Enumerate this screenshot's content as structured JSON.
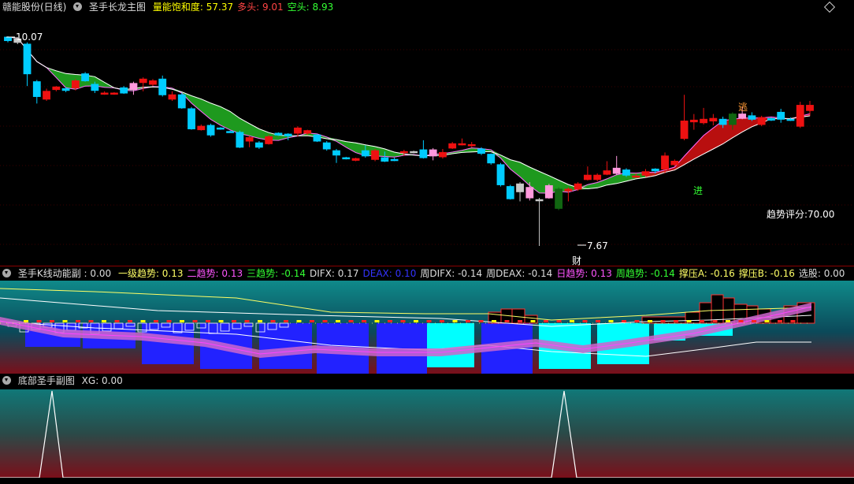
{
  "main": {
    "stock_name": "赣能股份(日线)",
    "indicator_name": "圣手长龙主图",
    "fields": [
      {
        "label": "量能饱和度:",
        "value": "57.37",
        "color": "#ffff00"
      },
      {
        "label": "多头:",
        "value": "9.01",
        "color": "#ff4444"
      },
      {
        "label": "空头:",
        "value": "8.93",
        "color": "#33ff33"
      }
    ],
    "high_label": "10.07",
    "low_label": "7.67",
    "escape_label": "逃",
    "enter_label": "进",
    "wealth_label": "财",
    "score_label": "趋势评分:70.00"
  },
  "sub1": {
    "indicator_name": "圣手K线动能副",
    "indicator_value": ": 0.00",
    "fields": [
      {
        "label": "一级趋势:",
        "value": "0.13",
        "color": "#ffff66"
      },
      {
        "label": "二趋势:",
        "value": "0.13",
        "color": "#ff55ff"
      },
      {
        "label": "三趋势:",
        "value": "-0.14",
        "color": "#33ff33"
      },
      {
        "label": "DIFX:",
        "value": "0.17",
        "color": "#dddddd"
      },
      {
        "label": "DEAX:",
        "value": "0.10",
        "color": "#3333ff"
      },
      {
        "label": "周DIFX:",
        "value": "-0.14",
        "color": "#dddddd"
      },
      {
        "label": "周DEAX:",
        "value": "-0.14",
        "color": "#dddddd"
      },
      {
        "label": "日趋势:",
        "value": "0.13",
        "color": "#ff55ff"
      },
      {
        "label": "周趋势:",
        "value": "-0.14",
        "color": "#33ff33"
      },
      {
        "label": "撑压A:",
        "value": "-0.16",
        "color": "#ffff66"
      },
      {
        "label": "撑压B:",
        "value": "-0.16",
        "color": "#ffff66"
      },
      {
        "label": "选股:",
        "value": "0.00",
        "color": "#dddddd"
      }
    ]
  },
  "sub2": {
    "indicator_name": "底部圣手副图",
    "fields": [
      {
        "label": "XG:",
        "value": "0.00",
        "color": "#dddddd"
      }
    ]
  },
  "chart_data": {
    "type": "candlestick",
    "candles": [
      {
        "o": 10.02,
        "c": 10.06,
        "h": 10.07,
        "l": 10.0,
        "color": "cyan"
      },
      {
        "o": 10.0,
        "c": 10.04,
        "h": 10.06,
        "l": 9.98,
        "color": "gray"
      },
      {
        "o": 9.98,
        "c": 9.64,
        "h": 10.0,
        "l": 9.5,
        "color": "cyan"
      },
      {
        "o": 9.55,
        "c": 9.38,
        "h": 9.57,
        "l": 9.3,
        "color": "cyan"
      },
      {
        "o": 9.35,
        "c": 9.44,
        "h": 9.47,
        "l": 9.33,
        "color": "red"
      },
      {
        "o": 9.46,
        "c": 9.49,
        "h": 9.5,
        "l": 9.44,
        "color": "red"
      },
      {
        "o": 9.47,
        "c": 9.45,
        "h": 9.49,
        "l": 9.43,
        "color": "cyan"
      },
      {
        "o": 9.48,
        "c": 9.56,
        "h": 9.58,
        "l": 9.45,
        "color": "red"
      },
      {
        "o": 9.64,
        "c": 9.56,
        "h": 9.66,
        "l": 9.55,
        "color": "cyan"
      },
      {
        "o": 9.52,
        "c": 9.45,
        "h": 9.55,
        "l": 9.42,
        "color": "cyan"
      },
      {
        "o": 9.42,
        "c": 9.41,
        "h": 9.44,
        "l": 9.4,
        "color": "red"
      },
      {
        "o": 9.42,
        "c": 9.42,
        "h": 9.43,
        "l": 9.4,
        "color": "red"
      },
      {
        "o": 9.48,
        "c": 9.42,
        "h": 9.5,
        "l": 9.41,
        "color": "cyan"
      },
      {
        "o": 9.46,
        "c": 9.53,
        "h": 9.55,
        "l": 9.4,
        "color": "pink"
      },
      {
        "o": 9.54,
        "c": 9.58,
        "h": 9.6,
        "l": 9.44,
        "color": "red"
      },
      {
        "o": 9.56,
        "c": 9.52,
        "h": 9.58,
        "l": 9.5,
        "color": "red"
      },
      {
        "o": 9.58,
        "c": 9.4,
        "h": 9.62,
        "l": 9.38,
        "color": "cyan"
      },
      {
        "o": 9.4,
        "c": 9.35,
        "h": 9.44,
        "l": 9.33,
        "color": "red"
      },
      {
        "o": 9.4,
        "c": 9.25,
        "h": 9.42,
        "l": 9.24,
        "color": "cyan"
      },
      {
        "o": 9.24,
        "c": 9.01,
        "h": 9.26,
        "l": 9.0,
        "color": "cyan"
      },
      {
        "o": 9.0,
        "c": 9.04,
        "h": 9.06,
        "l": 8.99,
        "color": "red"
      },
      {
        "o": 9.05,
        "c": 8.94,
        "h": 9.07,
        "l": 8.92,
        "color": "cyan"
      },
      {
        "o": 9.02,
        "c": 9.02,
        "h": 9.03,
        "l": 9.0,
        "color": "cyan"
      },
      {
        "o": 8.98,
        "c": 8.98,
        "h": 8.99,
        "l": 8.97,
        "color": "cyan"
      },
      {
        "o": 8.97,
        "c": 8.8,
        "h": 8.99,
        "l": 8.79,
        "color": "cyan"
      },
      {
        "o": 8.87,
        "c": 8.91,
        "h": 8.93,
        "l": 8.8,
        "color": "red"
      },
      {
        "o": 8.85,
        "c": 8.8,
        "h": 8.87,
        "l": 8.78,
        "color": "cyan"
      },
      {
        "o": 8.84,
        "c": 8.92,
        "h": 8.94,
        "l": 8.83,
        "color": "red"
      },
      {
        "o": 8.94,
        "c": 8.96,
        "h": 8.97,
        "l": 8.93,
        "color": "cyan"
      },
      {
        "o": 8.93,
        "c": 8.95,
        "h": 8.96,
        "l": 8.88,
        "color": "cyan"
      },
      {
        "o": 8.96,
        "c": 9.02,
        "h": 9.04,
        "l": 8.92,
        "color": "red"
      },
      {
        "o": 8.99,
        "c": 8.96,
        "h": 9.0,
        "l": 8.94,
        "color": "red"
      },
      {
        "o": 8.94,
        "c": 8.87,
        "h": 8.95,
        "l": 8.86,
        "color": "cyan"
      },
      {
        "o": 8.85,
        "c": 8.78,
        "h": 8.87,
        "l": 8.76,
        "color": "cyan"
      },
      {
        "o": 8.76,
        "c": 8.71,
        "h": 8.78,
        "l": 8.62,
        "color": "cyan"
      },
      {
        "o": 8.68,
        "c": 8.68,
        "h": 8.69,
        "l": 8.66,
        "color": "cyan"
      },
      {
        "o": 8.67,
        "c": 8.65,
        "h": 8.68,
        "l": 8.64,
        "color": "red"
      },
      {
        "o": 8.76,
        "c": 8.7,
        "h": 8.82,
        "l": 8.68,
        "color": "cyan"
      },
      {
        "o": 8.66,
        "c": 8.76,
        "h": 8.78,
        "l": 8.64,
        "color": "red"
      },
      {
        "o": 8.64,
        "c": 8.68,
        "h": 8.75,
        "l": 8.63,
        "color": "cyan"
      },
      {
        "o": 8.66,
        "c": 8.65,
        "h": 8.68,
        "l": 8.64,
        "color": "cyan"
      },
      {
        "o": 8.74,
        "c": 8.75,
        "h": 8.77,
        "l": 8.7,
        "color": "red"
      },
      {
        "o": 8.75,
        "c": 8.74,
        "h": 8.76,
        "l": 8.73,
        "color": "gray"
      },
      {
        "o": 8.77,
        "c": 8.68,
        "h": 8.88,
        "l": 8.67,
        "color": "cyan"
      },
      {
        "o": 8.7,
        "c": 8.77,
        "h": 8.79,
        "l": 8.65,
        "color": "pink"
      },
      {
        "o": 8.74,
        "c": 8.69,
        "h": 8.78,
        "l": 8.67,
        "color": "red"
      },
      {
        "o": 8.79,
        "c": 8.84,
        "h": 8.86,
        "l": 8.78,
        "color": "red"
      },
      {
        "o": 8.83,
        "c": 8.84,
        "h": 8.9,
        "l": 8.82,
        "color": "red"
      },
      {
        "o": 8.83,
        "c": 8.82,
        "h": 8.86,
        "l": 8.8,
        "color": "red"
      },
      {
        "o": 8.78,
        "c": 8.73,
        "h": 8.8,
        "l": 8.71,
        "color": "cyan"
      },
      {
        "o": 8.72,
        "c": 8.62,
        "h": 8.73,
        "l": 8.6,
        "color": "cyan"
      },
      {
        "o": 8.6,
        "c": 8.37,
        "h": 8.62,
        "l": 8.35,
        "color": "cyan"
      },
      {
        "o": 8.35,
        "c": 8.21,
        "h": 8.37,
        "l": 8.2,
        "color": "cyan"
      },
      {
        "o": 8.29,
        "c": 8.38,
        "h": 8.4,
        "l": 8.18,
        "color": "gray"
      },
      {
        "o": 8.34,
        "c": 8.22,
        "h": 8.4,
        "l": 8.19,
        "color": "pink"
      },
      {
        "o": 8.2,
        "c": 8.2,
        "h": 8.22,
        "l": 7.67,
        "color": "gray"
      },
      {
        "o": 8.22,
        "c": 8.36,
        "h": 8.38,
        "l": 8.21,
        "color": "pink"
      },
      {
        "o": 8.1,
        "c": 8.32,
        "h": 8.34,
        "l": 8.08,
        "color": "green"
      },
      {
        "o": 8.3,
        "c": 8.32,
        "h": 8.34,
        "l": 8.18,
        "color": "red"
      },
      {
        "o": 8.32,
        "c": 8.38,
        "h": 8.4,
        "l": 8.3,
        "color": "red"
      },
      {
        "o": 8.43,
        "c": 8.48,
        "h": 8.58,
        "l": 8.42,
        "color": "red"
      },
      {
        "o": 8.43,
        "c": 8.48,
        "h": 8.5,
        "l": 8.41,
        "color": "red"
      },
      {
        "o": 8.49,
        "c": 8.53,
        "h": 8.64,
        "l": 8.48,
        "color": "red"
      },
      {
        "o": 8.5,
        "c": 8.56,
        "h": 8.7,
        "l": 8.48,
        "color": "pink"
      },
      {
        "o": 8.54,
        "c": 8.48,
        "h": 8.56,
        "l": 8.46,
        "color": "cyan"
      },
      {
        "o": 8.46,
        "c": 8.47,
        "h": 8.5,
        "l": 8.45,
        "color": "red"
      },
      {
        "o": 8.48,
        "c": 8.52,
        "h": 8.55,
        "l": 8.47,
        "color": "red"
      },
      {
        "o": 8.55,
        "c": 8.53,
        "h": 8.56,
        "l": 8.5,
        "color": "cyan"
      },
      {
        "o": 8.55,
        "c": 8.7,
        "h": 8.74,
        "l": 8.5,
        "color": "red"
      },
      {
        "o": 8.6,
        "c": 8.64,
        "h": 8.66,
        "l": 8.58,
        "color": "red"
      },
      {
        "o": 8.9,
        "c": 9.1,
        "h": 9.4,
        "l": 8.88,
        "color": "red"
      },
      {
        "o": 9.09,
        "c": 9.11,
        "h": 9.18,
        "l": 9.0,
        "color": "red"
      },
      {
        "o": 9.08,
        "c": 9.12,
        "h": 9.25,
        "l": 9.06,
        "color": "red"
      },
      {
        "o": 9.1,
        "c": 9.13,
        "h": 9.18,
        "l": 9.05,
        "color": "red"
      },
      {
        "o": 9.12,
        "c": 9.06,
        "h": 9.15,
        "l": 9.02,
        "color": "cyan"
      },
      {
        "o": 9.06,
        "c": 9.18,
        "h": 9.2,
        "l": 9.0,
        "color": "green"
      },
      {
        "o": 9.13,
        "c": 9.18,
        "h": 9.26,
        "l": 9.12,
        "color": "pink"
      },
      {
        "o": 9.16,
        "c": 9.12,
        "h": 9.2,
        "l": 9.1,
        "color": "cyan"
      },
      {
        "o": 9.06,
        "c": 9.14,
        "h": 9.16,
        "l": 9.04,
        "color": "red"
      },
      {
        "o": 9.13,
        "c": 9.11,
        "h": 9.14,
        "l": 9.1,
        "color": "cyan"
      },
      {
        "o": 9.2,
        "c": 9.12,
        "h": 9.24,
        "l": 9.08,
        "color": "cyan"
      },
      {
        "o": 9.12,
        "c": 9.12,
        "h": 9.14,
        "l": 9.1,
        "color": "cyan"
      },
      {
        "o": 9.04,
        "c": 9.28,
        "h": 9.32,
        "l": 9.02,
        "color": "red"
      },
      {
        "o": 9.22,
        "c": 9.28,
        "h": 9.33,
        "l": 9.18,
        "color": "red"
      }
    ],
    "high": 10.07,
    "low": 7.67
  }
}
